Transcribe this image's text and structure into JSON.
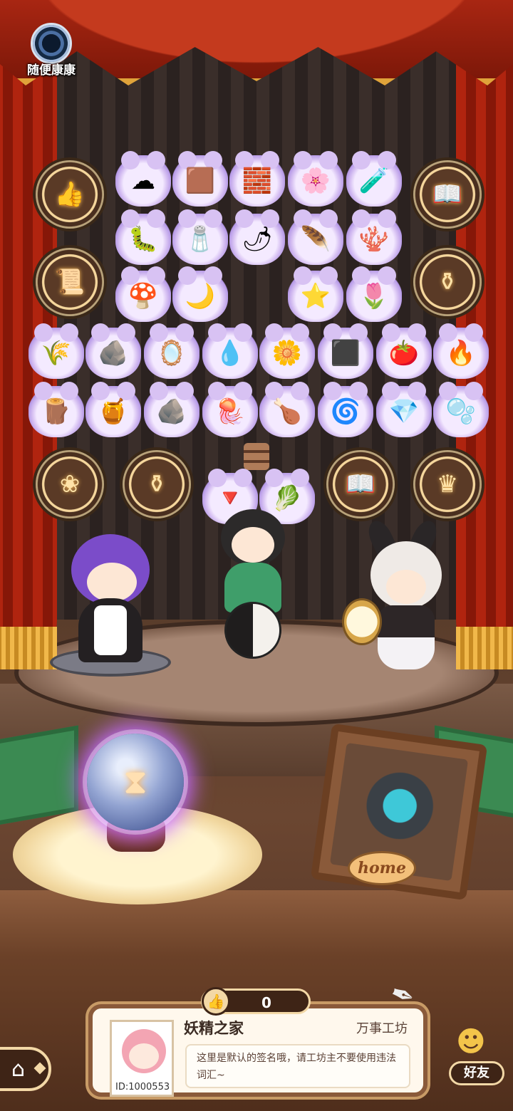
{
  "user": {
    "name": "随便康康",
    "icon": "portal-icon"
  },
  "grid": {
    "medals": [
      {
        "name": "medal-thumbsup",
        "glyph": "👍"
      },
      {
        "name": "medal-book",
        "glyph": "📖"
      },
      {
        "name": "medal-scroll",
        "glyph": "📜"
      },
      {
        "name": "medal-cauldron",
        "glyph": "⚱"
      },
      {
        "name": "medal-flower",
        "glyph": "❀"
      },
      {
        "name": "medal-pot",
        "glyph": "⚱"
      },
      {
        "name": "medal-book-2",
        "glyph": "📖"
      },
      {
        "name": "medal-dress",
        "glyph": "♛"
      }
    ],
    "items": [
      {
        "name": "cotton-icon",
        "glyph": "☁"
      },
      {
        "name": "mud-icon",
        "glyph": "🟫"
      },
      {
        "name": "copper-ore-icon",
        "glyph": "🧱"
      },
      {
        "name": "purple-flower-icon",
        "glyph": "🌸"
      },
      {
        "name": "potion-icon",
        "glyph": "🧪"
      },
      {
        "name": "cocoon-icon",
        "glyph": "🐛"
      },
      {
        "name": "salt-icon",
        "glyph": "🧂"
      },
      {
        "name": "chili-icon",
        "glyph": "🌶"
      },
      {
        "name": "feather-icon",
        "glyph": "🪶"
      },
      {
        "name": "coral-icon",
        "glyph": "🪸"
      },
      {
        "name": "mushroom-icon",
        "glyph": "🍄"
      },
      {
        "name": "moon-icon",
        "glyph": "🌙"
      },
      {
        "name": "star-icon",
        "glyph": "⭐"
      },
      {
        "name": "lily-icon",
        "glyph": "🌷"
      },
      {
        "name": "wheat-icon",
        "glyph": "🌾"
      },
      {
        "name": "flint-icon",
        "glyph": "🪨"
      },
      {
        "name": "mirror-icon",
        "glyph": "🪞"
      },
      {
        "name": "slime-icon",
        "glyph": "💧"
      },
      {
        "name": "dandelion-icon",
        "glyph": "🌼"
      },
      {
        "name": "coal-icon",
        "glyph": "⬛"
      },
      {
        "name": "tomato-icon",
        "glyph": "🍅"
      },
      {
        "name": "lava-rock-icon",
        "glyph": "🔥"
      },
      {
        "name": "wood-icon",
        "glyph": "🪵"
      },
      {
        "name": "honeycomb-icon",
        "glyph": "🍯"
      },
      {
        "name": "pebbles-icon",
        "glyph": "🪨"
      },
      {
        "name": "jellyfish-icon",
        "glyph": "🪼"
      },
      {
        "name": "drumstick-icon",
        "glyph": "🍗"
      },
      {
        "name": "blue-flower-icon",
        "glyph": "🌀"
      },
      {
        "name": "crystal-icon",
        "glyph": "💎"
      },
      {
        "name": "blue-drop-icon",
        "glyph": "🫧"
      },
      {
        "name": "red-crystal-icon",
        "glyph": "🔻"
      },
      {
        "name": "leek-icon",
        "glyph": "🥬"
      }
    ]
  },
  "crystal_ball": {
    "icon": "hourglass-icon",
    "glyph": "⧗"
  },
  "home_frame": {
    "label": "home"
  },
  "likes": {
    "icon": "thumbs-up-icon",
    "glyph": "👍",
    "count": "0"
  },
  "profile": {
    "title": "妖精之家",
    "tag": "万事工坊",
    "signature": "这里是默认的签名哦，请工坊主不要使用违法词汇~",
    "id": "ID:1000553"
  },
  "nav": {
    "home_glyph": "⌂",
    "friends_glyph": "☻",
    "friends_label": "好友",
    "quill_glyph": "✒"
  }
}
